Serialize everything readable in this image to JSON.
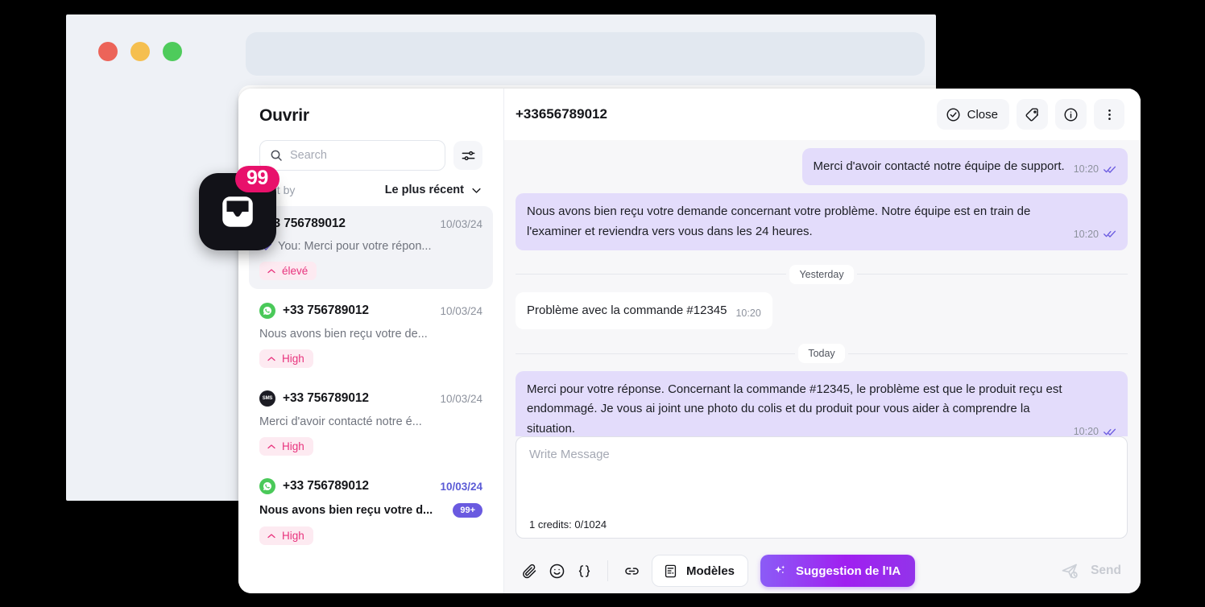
{
  "browser": {
    "traffic_lights": [
      "close",
      "minimize",
      "maximize"
    ],
    "url_bar_value": ""
  },
  "app_icon": {
    "name": "inbox-icon",
    "badge_count": "99"
  },
  "sidebar": {
    "title": "Ouvrir",
    "search": {
      "placeholder": "Search",
      "value": ""
    },
    "filter_button_label": "",
    "sort": {
      "label": "Sort by",
      "value": "Le plus récent"
    },
    "conversations": [
      {
        "number": "+33 756789012",
        "date": "10/03/24",
        "preview": "You: Merci pour votre répon...",
        "priority": "élevé",
        "channel": "none",
        "selected": true,
        "unread": false,
        "read_receipt": true,
        "unread_badge": ""
      },
      {
        "number": "+33 756789012",
        "date": "10/03/24",
        "preview": "Nous avons bien reçu votre de...",
        "priority": "High",
        "channel": "whatsapp",
        "selected": false,
        "unread": false,
        "read_receipt": false,
        "unread_badge": ""
      },
      {
        "number": "+33 756789012",
        "date": "10/03/24",
        "preview": "Merci d'avoir contacté notre é...",
        "priority": "High",
        "channel": "sms",
        "selected": false,
        "unread": false,
        "read_receipt": false,
        "unread_badge": ""
      },
      {
        "number": "+33 756789012",
        "date": "10/03/24",
        "preview": "Nous avons bien reçu votre d...",
        "priority": "High",
        "channel": "whatsapp",
        "selected": false,
        "unread": true,
        "read_receipt": false,
        "unread_badge": "99+"
      }
    ]
  },
  "chat": {
    "title": "+33656789012",
    "actions": {
      "close_label": "Close",
      "tag_label": "",
      "info_label": "",
      "more_label": ""
    },
    "messages": [
      {
        "id": "m1",
        "direction": "out",
        "text": "Merci d'avoir contacté notre équipe de support.",
        "time": "10:20",
        "receipt": true
      },
      {
        "id": "m2",
        "direction": "out",
        "text": "Nous avons bien reçu votre demande concernant votre problème. Notre équipe est en train de l'examiner et reviendra vers vous dans les 24 heures.",
        "time": "10:20",
        "receipt": true
      },
      {
        "id": "sep1",
        "direction": "separator",
        "text": "Yesterday"
      },
      {
        "id": "m3",
        "direction": "in",
        "text": "Problème avec la commande #12345",
        "time": "10:20",
        "receipt": false
      },
      {
        "id": "sep2",
        "direction": "separator",
        "text": "Today"
      },
      {
        "id": "m4",
        "direction": "out",
        "text": "Merci pour votre réponse. Concernant la commande #12345, le problème est que le produit reçu est endommagé. Je vous ai joint une photo du colis et du produit pour vous aider à comprendre la situation.",
        "time": "10:20",
        "receipt": true
      }
    ],
    "composer": {
      "placeholder": "Write Message",
      "value": "",
      "credits": "1 credits: 0/1024",
      "tools": [
        {
          "name": "attach-icon",
          "label": ""
        },
        {
          "name": "emoji-icon",
          "label": ""
        },
        {
          "name": "variable-icon",
          "label": ""
        },
        {
          "name": "link-icon",
          "label": ""
        }
      ],
      "templates_label": "Modèles",
      "ai_suggestion_label": "Suggestion de l'IA",
      "send_label": "Send"
    }
  },
  "colors": {
    "accent_purple": "#6a5ae0",
    "bubble_out": "#e3dcfb",
    "bubble_in": "#ffffff",
    "priority_pink_bg": "#fdeaf1",
    "priority_pink_text": "#e8337d",
    "badge_pink": "#e8116b",
    "ai_gradient_start": "#8b5cf6",
    "ai_gradient_end": "#9333ea",
    "whatsapp_green": "#4ac959",
    "page_bg": "#000000"
  }
}
